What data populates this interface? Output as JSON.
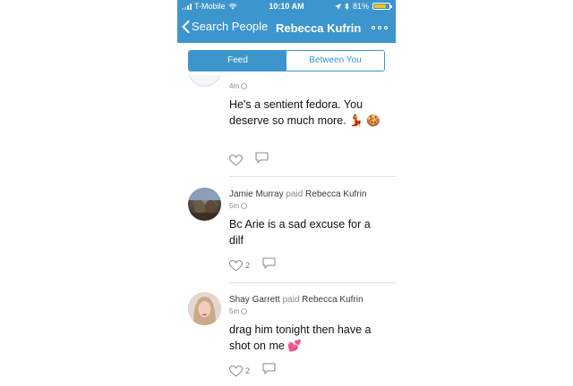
{
  "status_bar": {
    "carrier": "T-Mobile",
    "time": "10:10 AM",
    "battery": "81%",
    "battery_color": "#f5c400"
  },
  "nav": {
    "back_label": "Search People",
    "title": "Rebecca Kufrin",
    "accent": "#3d95ce"
  },
  "segments": {
    "feed": "Feed",
    "between": "Between You",
    "active": "feed"
  },
  "stories": [
    {
      "time": "4m",
      "note": "He's a sentient fedora. You deserve so much more. 💃 🍪",
      "likes": "",
      "visibility_icon": "globe-icon"
    },
    {
      "author": "Jamie Murray",
      "action": "paid",
      "target": "Rebecca Kufrin",
      "time": "5m",
      "note": "Bc Arie is a sad excuse for a dilf",
      "likes": "2",
      "visibility_icon": "globe-icon"
    },
    {
      "author": "Shay Garrett",
      "action": "paid",
      "target": "Rebecca Kufrin",
      "time": "5m",
      "note": "drag him tonight then have a shot on me 💕",
      "likes": "2",
      "visibility_icon": "globe-icon"
    }
  ]
}
